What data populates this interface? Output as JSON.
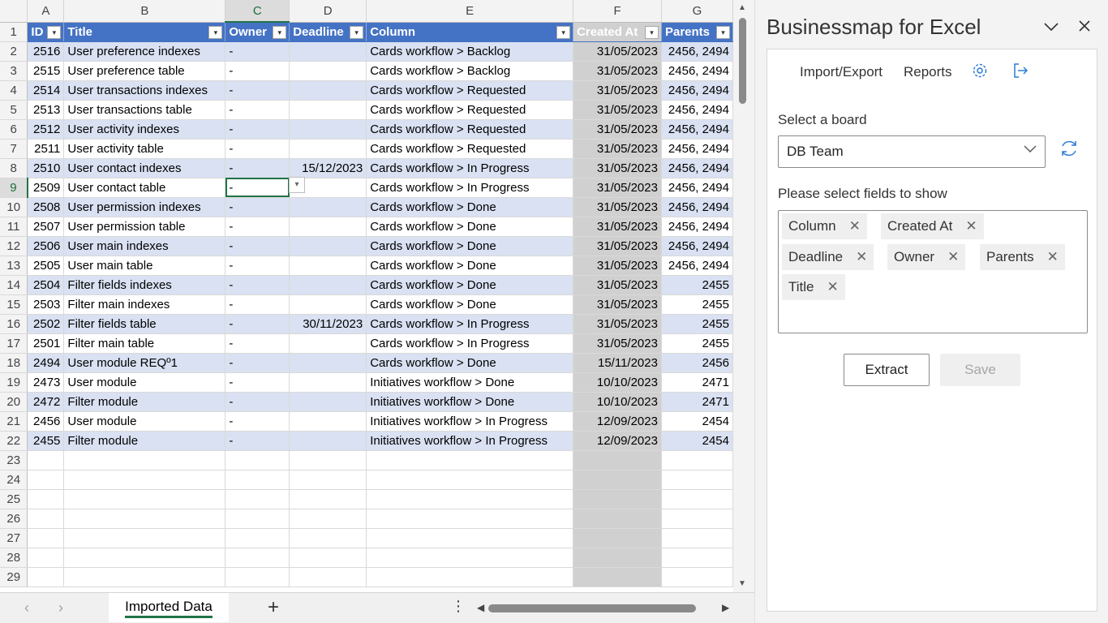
{
  "columns": [
    "A",
    "B",
    "C",
    "D",
    "E",
    "F",
    "G"
  ],
  "table_headers": [
    "ID",
    "Title",
    "Owner",
    "Deadline",
    "Column",
    "Created At",
    "Parents"
  ],
  "rows": [
    [
      "2516",
      "User preference indexes",
      "-",
      "",
      "Cards workflow > Backlog",
      "31/05/2023",
      "2456, 2494"
    ],
    [
      "2515",
      "User preference table",
      "-",
      "",
      "Cards workflow > Backlog",
      "31/05/2023",
      "2456, 2494"
    ],
    [
      "2514",
      "User transactions indexes",
      "-",
      "",
      "Cards workflow > Requested",
      "31/05/2023",
      "2456, 2494"
    ],
    [
      "2513",
      "User transactions table",
      "-",
      "",
      "Cards workflow > Requested",
      "31/05/2023",
      "2456, 2494"
    ],
    [
      "2512",
      "User activity indexes",
      "-",
      "",
      "Cards workflow > Requested",
      "31/05/2023",
      "2456, 2494"
    ],
    [
      "2511",
      "User activity table",
      "-",
      "",
      "Cards workflow > Requested",
      "31/05/2023",
      "2456, 2494"
    ],
    [
      "2510",
      "User contact indexes",
      "-",
      "15/12/2023",
      "Cards workflow > In Progress",
      "31/05/2023",
      "2456, 2494"
    ],
    [
      "2509",
      "User contact table",
      "-",
      "",
      "Cards workflow > In Progress",
      "31/05/2023",
      "2456, 2494"
    ],
    [
      "2508",
      "User permission indexes",
      "-",
      "",
      "Cards workflow > Done",
      "31/05/2023",
      "2456, 2494"
    ],
    [
      "2507",
      "User permission table",
      "-",
      "",
      "Cards workflow > Done",
      "31/05/2023",
      "2456, 2494"
    ],
    [
      "2506",
      "User main indexes",
      "-",
      "",
      "Cards workflow > Done",
      "31/05/2023",
      "2456, 2494"
    ],
    [
      "2505",
      "User main table",
      "-",
      "",
      "Cards workflow > Done",
      "31/05/2023",
      "2456, 2494"
    ],
    [
      "2504",
      "Filter fields indexes",
      "-",
      "",
      "Cards workflow > Done",
      "31/05/2023",
      "2455"
    ],
    [
      "2503",
      "Filter main indexes",
      "-",
      "",
      "Cards workflow > Done",
      "31/05/2023",
      "2455"
    ],
    [
      "2502",
      "Filter fields table",
      "-",
      "30/11/2023",
      "Cards workflow > In Progress",
      "31/05/2023",
      "2455"
    ],
    [
      "2501",
      "Filter main table",
      "-",
      "",
      "Cards workflow > In Progress",
      "31/05/2023",
      "2455"
    ],
    [
      "2494",
      "User module REQº1",
      "-",
      "",
      "Cards workflow > Done",
      "15/11/2023",
      "2456"
    ],
    [
      "2473",
      "User module",
      "-",
      "",
      "Initiatives workflow > Done",
      "10/10/2023",
      "2471"
    ],
    [
      "2472",
      "Filter module",
      "-",
      "",
      "Initiatives workflow > Done",
      "10/10/2023",
      "2471"
    ],
    [
      "2456",
      "User module",
      "-",
      "",
      "Initiatives workflow > In Progress",
      "12/09/2023",
      "2454"
    ],
    [
      "2455",
      "Filter module",
      "-",
      "",
      "Initiatives workflow > In Progress",
      "12/09/2023",
      "2454"
    ]
  ],
  "empty_row_numbers": [
    "23",
    "24",
    "25",
    "26",
    "27",
    "28",
    "29"
  ],
  "sheet": {
    "tab_name": "Imported Data",
    "add_label": "+",
    "more_label": "⋮"
  },
  "pane": {
    "title": "Businessmap for Excel",
    "nav_import_export": "Import/Export",
    "nav_reports": "Reports",
    "board_label": "Select a board",
    "board_value": "DB Team",
    "fields_label": "Please select fields to show",
    "fields": [
      "Column",
      "Created At",
      "Deadline",
      "Owner",
      "Parents",
      "Title"
    ],
    "extract_label": "Extract",
    "save_label": "Save"
  },
  "colors": {
    "table_header": "#4472c4",
    "band": "#d9e1f2",
    "accent": "#217346",
    "link": "#2b7cd3"
  }
}
